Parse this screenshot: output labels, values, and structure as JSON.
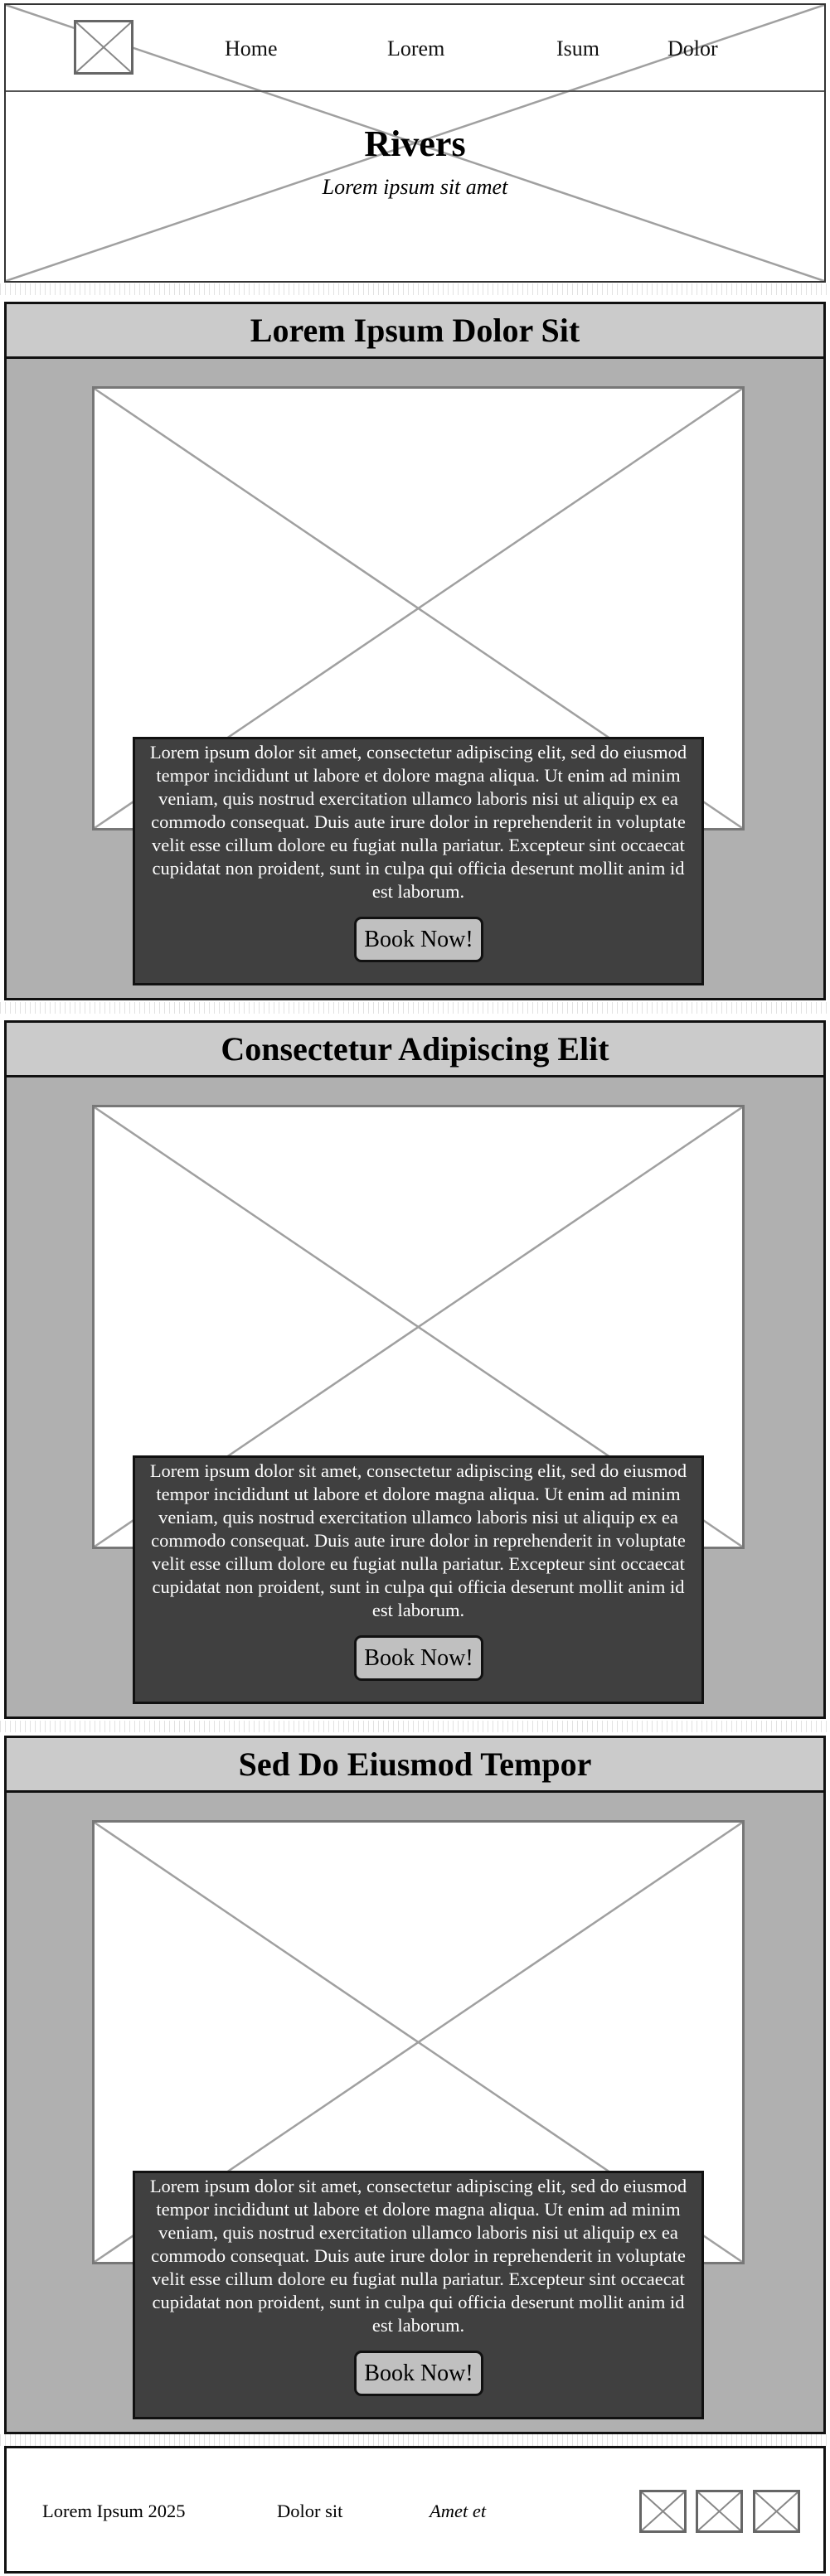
{
  "header": {
    "nav": [
      "Home",
      "Lorem",
      "Isum",
      "Dolor"
    ],
    "title": "Rivers",
    "subtitle": "Lorem ipsum sit amet"
  },
  "sections": [
    {
      "title": "Lorem Ipsum Dolor Sit",
      "text": "Lorem ipsum dolor sit amet, consectetur adipiscing elit, sed do eiusmod tempor incididunt ut labore et dolore magna aliqua. Ut enim ad minim veniam, quis nostrud exercitation ullamco laboris nisi ut aliquip ex ea commodo consequat. Duis aute irure dolor in reprehenderit in voluptate velit esse cillum dolore eu fugiat nulla pariatur. Excepteur sint occaecat cupidatat non proident, sunt in culpa qui officia deserunt mollit anim id est laborum.",
      "button": "Book Now!"
    },
    {
      "title": "Consectetur Adipiscing Elit",
      "text": "Lorem ipsum dolor sit amet, consectetur adipiscing elit, sed do eiusmod tempor incididunt ut labore et dolore magna aliqua. Ut enim ad minim veniam, quis nostrud exercitation ullamco laboris nisi ut aliquip ex ea commodo consequat. Duis aute irure dolor in reprehenderit in voluptate velit esse cillum dolore eu fugiat nulla pariatur. Excepteur sint occaecat cupidatat non proident, sunt in culpa qui officia deserunt mollit anim id est laborum.",
      "button": "Book Now!"
    },
    {
      "title": "Sed Do Eiusmod Tempor",
      "text": "Lorem ipsum dolor sit amet, consectetur adipiscing elit, sed do eiusmod tempor incididunt ut labore et dolore magna aliqua. Ut enim ad minim veniam, quis nostrud exercitation ullamco laboris nisi ut aliquip ex ea commodo consequat. Duis aute irure dolor in reprehenderit in voluptate velit esse cillum dolore eu fugiat nulla pariatur. Excepteur sint occaecat cupidatat non proident, sunt in culpa qui officia deserunt mollit anim id est laborum.",
      "button": "Book Now!"
    }
  ],
  "footer": {
    "copyright": "Lorem Ipsum 2025",
    "link": "Dolor sit",
    "tagline": "Amet et"
  },
  "colors": {
    "section_background": "#b0b0b0",
    "section_header": "#cbcbcb",
    "card_background": "#404040",
    "button_background": "#c0c0c0",
    "placeholder_line": "#a0a0a0"
  },
  "icons": [
    "logo-placeholder-icon",
    "image-placeholder-icon",
    "social-placeholder-icon"
  ]
}
